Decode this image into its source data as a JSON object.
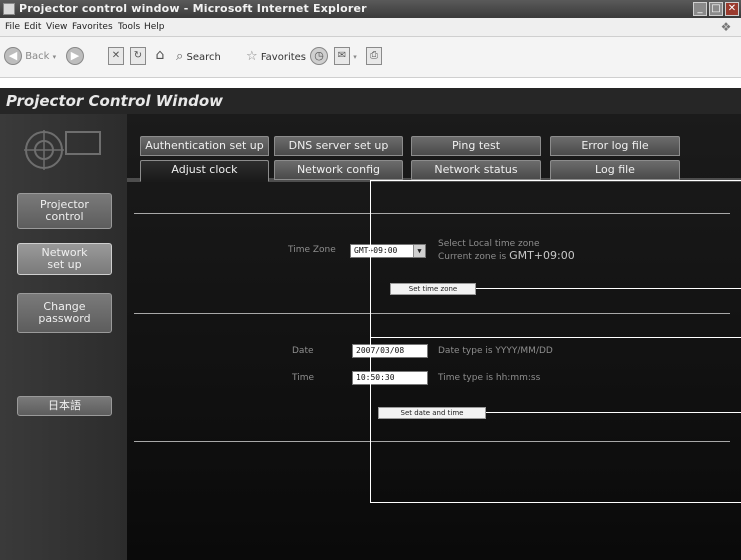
{
  "window": {
    "title": "Projector control window - Microsoft Internet Explorer",
    "controls": [
      "minimize-icon",
      "maximize-icon",
      "close-icon"
    ]
  },
  "menubar": {
    "items": [
      "File",
      "Edit",
      "View",
      "Favorites",
      "Tools",
      "Help"
    ]
  },
  "toolbar": {
    "back_label": "Back",
    "search_label": "Search",
    "favorites_label": "Favorites"
  },
  "header": {
    "title": "Projector Control Window"
  },
  "sidebar": {
    "buttons": [
      {
        "label": "Projector\ncontrol"
      },
      {
        "label": "Network\nset up"
      },
      {
        "label": "Change\npassword"
      },
      {
        "label": "日本語"
      }
    ]
  },
  "tabs": {
    "row1": [
      "Authentication set up",
      "DNS server set up",
      "Ping test",
      "Error log file"
    ],
    "row2": [
      "Adjust clock",
      "Network config",
      "Network status",
      "Log file"
    ],
    "active": "Adjust clock"
  },
  "timezone": {
    "label": "Time Zone",
    "value": "GMT+09:00",
    "hint_line1": "Select Local time zone",
    "hint_line2_prefix": "Current zone is",
    "hint_current": "GMT+09:00",
    "button": "Set time zone"
  },
  "datetime": {
    "date_label": "Date",
    "date_value": "2007/03/08",
    "date_hint": "Date type is YYYY/MM/DD",
    "time_label": "Time",
    "time_value": "10:50:30",
    "time_hint": "Time type is hh:mm:ss",
    "button": "Set date and time"
  },
  "colors": {
    "header_bg": "#262626",
    "content_bg": "#111111",
    "callout_lines": "#ffffff"
  }
}
